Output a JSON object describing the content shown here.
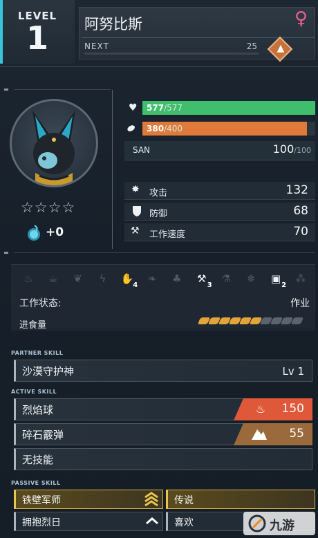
{
  "header": {
    "level_label": "LEVEL",
    "level_value": "1",
    "pal_name": "阿努比斯",
    "gender_icon": "female-symbol-icon",
    "next_label": "NEXT",
    "next_value": "25",
    "next_progress": 0
  },
  "portrait": {
    "icon": "anubis-portrait",
    "stars_text": "☆☆☆☆",
    "star_count": 0,
    "soul_bonus": "+0"
  },
  "stats": {
    "hp": {
      "icon": "heart-icon",
      "value": "577",
      "max": "/577",
      "fill": 1.0,
      "color": "#3fbe6e"
    },
    "food": {
      "icon": "food-icon",
      "value": "380",
      "max": "/400",
      "fill": 0.95,
      "color": "#df7a3a"
    },
    "san": {
      "label": "SAN",
      "value": "100",
      "max": "/100"
    },
    "attack": {
      "icon": "attack-icon",
      "label": "攻击",
      "value": "132"
    },
    "defense": {
      "icon": "shield-icon",
      "label": "防御",
      "value": "68"
    },
    "work_speed": {
      "icon": "hammer-icon",
      "label": "工作速度",
      "value": "70"
    }
  },
  "work": {
    "suitability": [
      {
        "icon": "kindling-icon",
        "active": false,
        "level": ""
      },
      {
        "icon": "watering-icon",
        "active": false,
        "level": ""
      },
      {
        "icon": "planting-icon",
        "active": false,
        "level": ""
      },
      {
        "icon": "electricity-icon",
        "active": false,
        "level": ""
      },
      {
        "icon": "handiwork-icon",
        "active": true,
        "level": "4"
      },
      {
        "icon": "gathering-icon",
        "active": false,
        "level": ""
      },
      {
        "icon": "lumbering-icon",
        "active": false,
        "level": ""
      },
      {
        "icon": "mining-icon",
        "active": true,
        "level": "3"
      },
      {
        "icon": "medicine-icon",
        "active": false,
        "level": ""
      },
      {
        "icon": "cooling-icon",
        "active": false,
        "level": ""
      },
      {
        "icon": "transporting-icon",
        "active": true,
        "level": "2"
      },
      {
        "icon": "farming-icon",
        "active": false,
        "level": ""
      }
    ],
    "status_label": "工作状态:",
    "status_value": "作业",
    "food_label": "进食量",
    "food_filled": 6,
    "food_total": 10
  },
  "skills": {
    "partner_label": "PARTNER SKILL",
    "partner": {
      "name": "沙漠守护神",
      "level": "Lv 1"
    },
    "active_label": "ACTIVE SKILL",
    "active": [
      {
        "name": "烈焰球",
        "element_icon": "fire-icon",
        "power": "150",
        "tag_color": "#e0583a"
      },
      {
        "name": "碎石霰弹",
        "element_icon": "ground-icon",
        "power": "55",
        "tag_color": "#9a6a3c"
      },
      {
        "name": "无技能"
      }
    ],
    "passive_label": "PASSIVE SKILL",
    "passive": [
      {
        "name": "铁壁军师",
        "rank_icon": "triple-chevron-up-icon",
        "gold": true
      },
      {
        "name": "传说",
        "gold": true
      },
      {
        "name": "拥抱烈日",
        "rank_icon": "chevron-up-icon",
        "gold": false
      },
      {
        "name": "喜欢",
        "gold": false
      }
    ]
  },
  "watermark": {
    "text": "九游"
  }
}
